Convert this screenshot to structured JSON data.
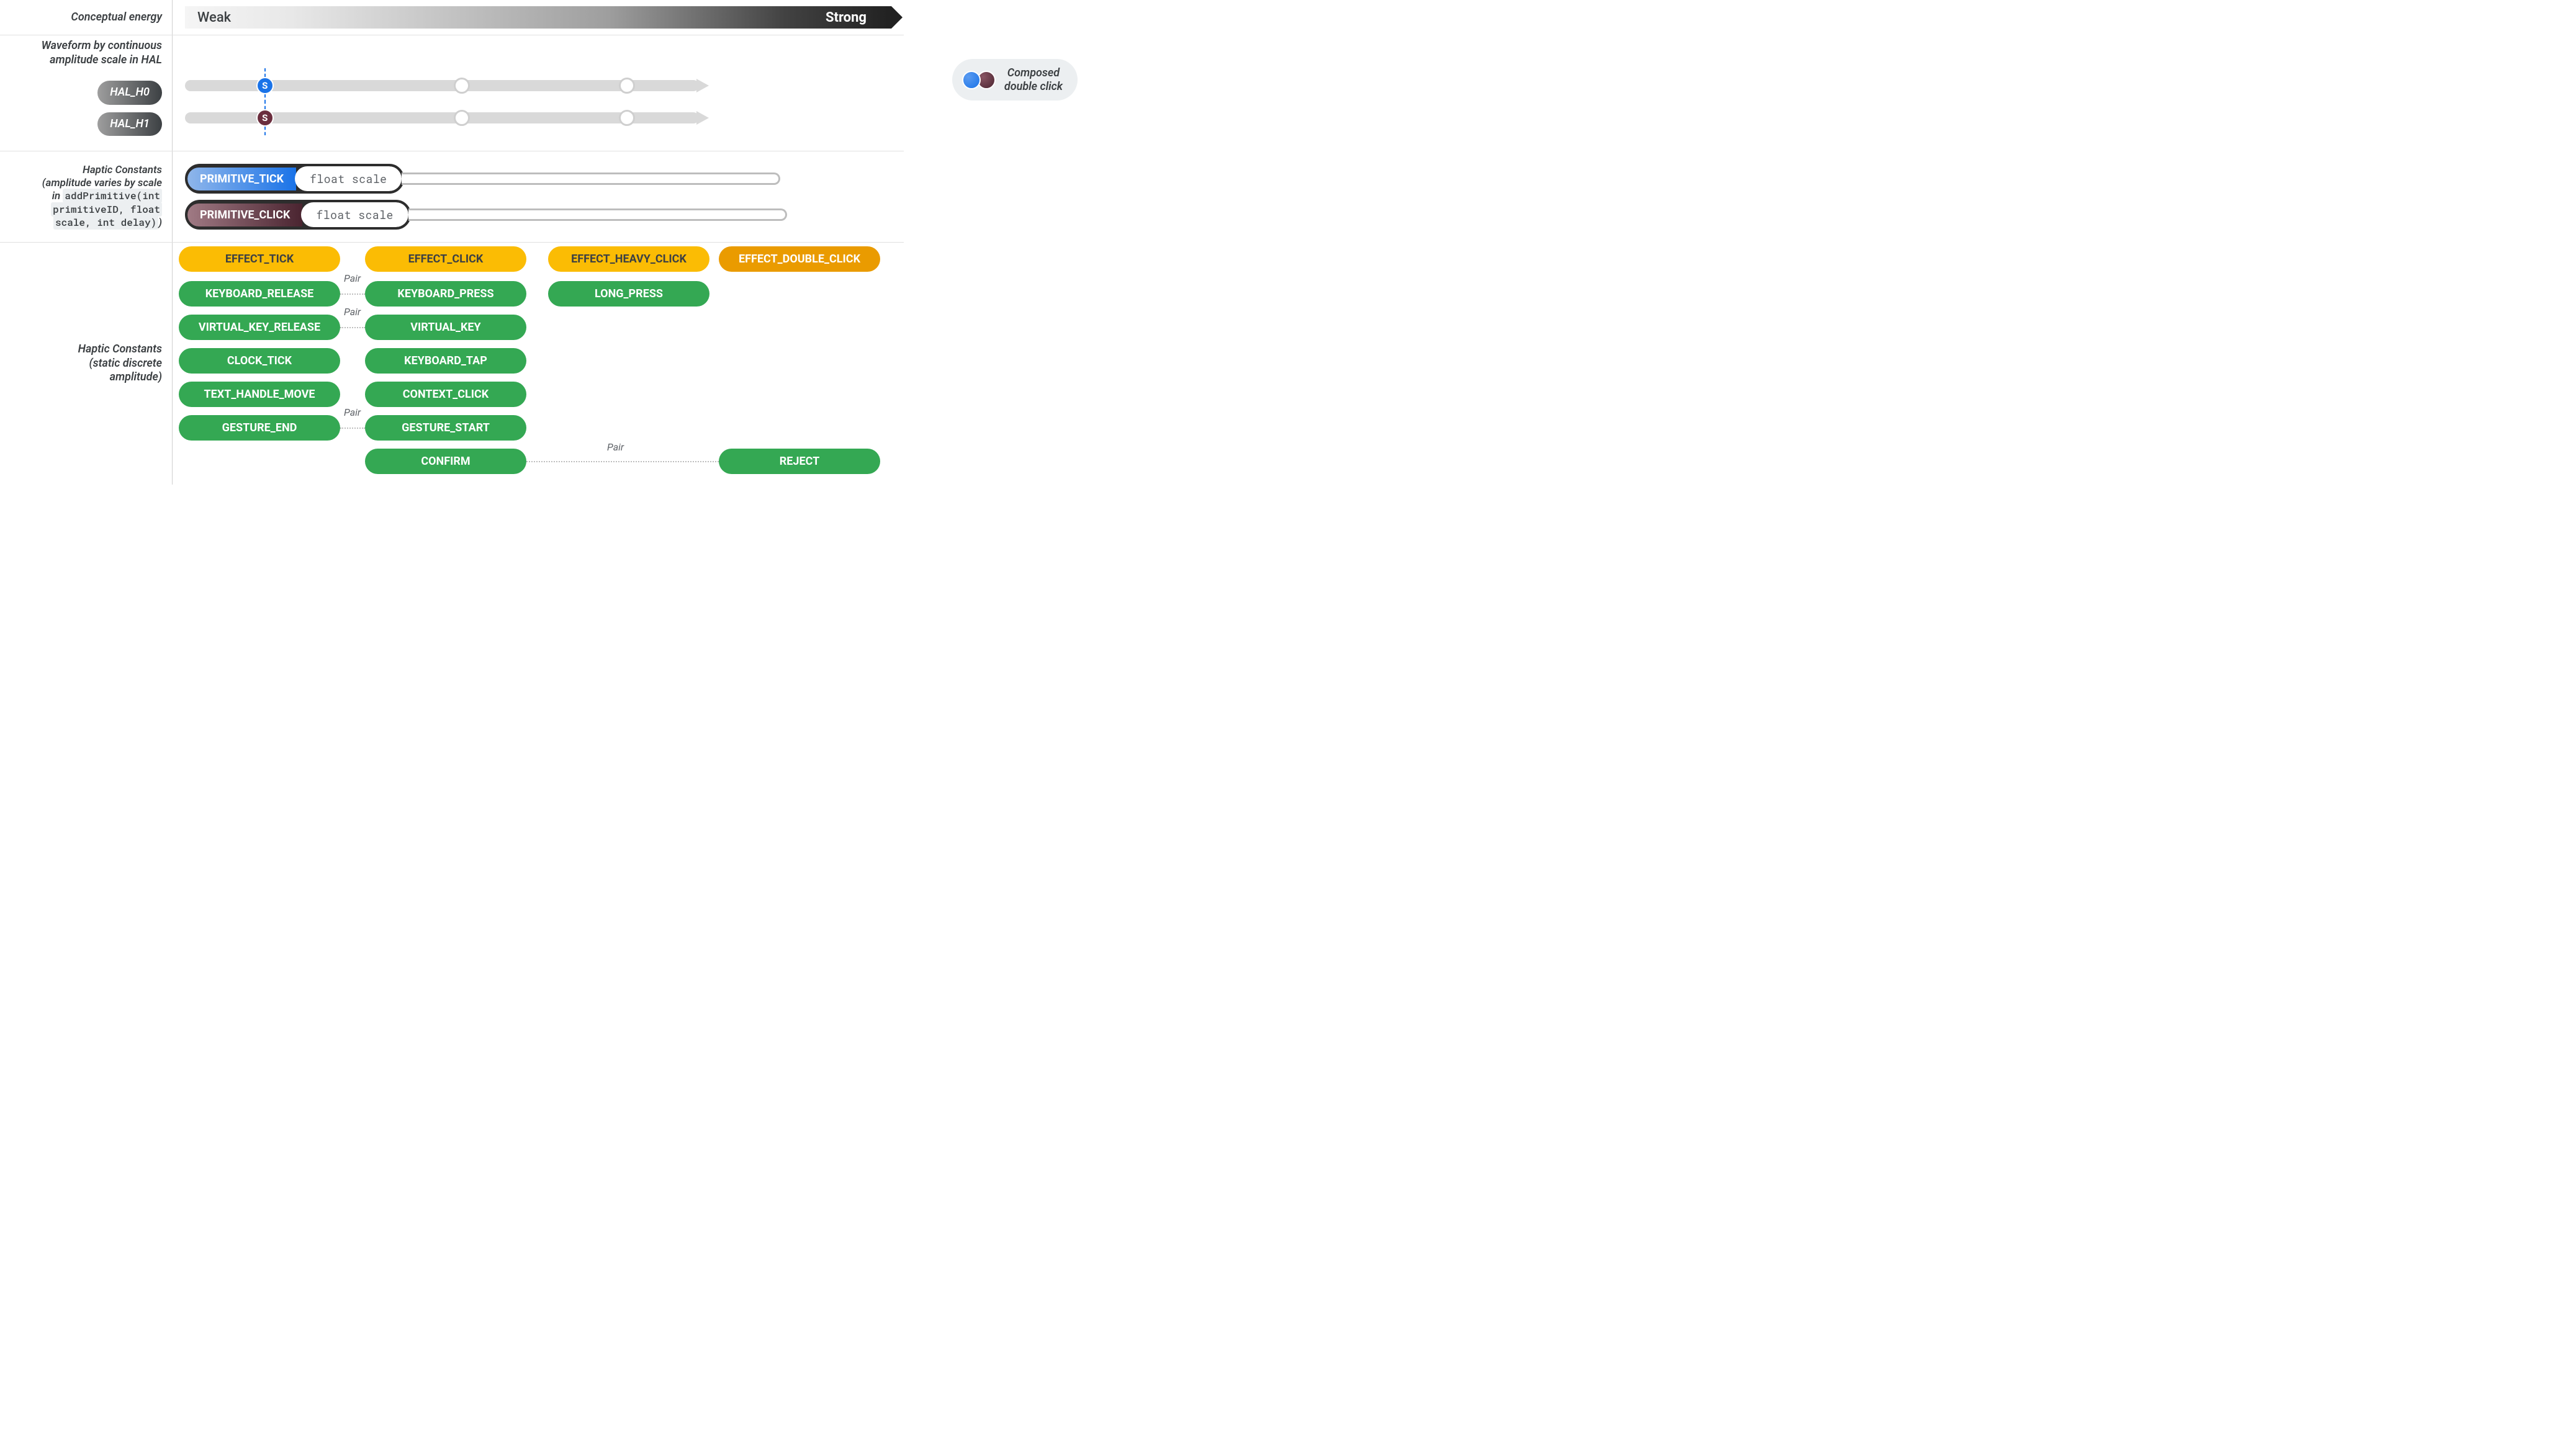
{
  "energy": {
    "title": "Conceptual energy",
    "weak": "Weak",
    "strong": "Strong"
  },
  "waveform": {
    "title_l1": "Waveform by continuous",
    "title_l2": "amplitude scale in HAL",
    "hal_h0": "HAL_H0",
    "hal_h1": "HAL_H1",
    "s_label": "S",
    "composed_l1": "Composed",
    "composed_l2": "double click"
  },
  "primitives": {
    "title_l1": "Haptic Constants",
    "title_l2": "(amplitude varies by scale",
    "title_l3_pre": "in ",
    "title_l3_code": "addPrimitive(int",
    "title_l4_code": "primitiveID, float",
    "title_l5_code": "scale, int delay)",
    "title_l5_post": ")",
    "tick": "PRIMITIVE_TICK",
    "click": "PRIMITIVE_CLICK",
    "float_scale": "float scale"
  },
  "static_row": {
    "title_l1": "Haptic Constants",
    "title_l2": "(static discrete",
    "title_l3": "amplitude)"
  },
  "pair_label": "Pair",
  "effects": {
    "tick": "EFFECT_TICK",
    "click": "EFFECT_CLICK",
    "heavy": "EFFECT_HEAVY_CLICK",
    "double": "EFFECT_DOUBLE_CLICK"
  },
  "constants": {
    "keyboard_release": "KEYBOARD_RELEASE",
    "keyboard_press": "KEYBOARD_PRESS",
    "long_press": "LONG_PRESS",
    "virtual_key_release": "VIRTUAL_KEY_RELEASE",
    "virtual_key": "VIRTUAL_KEY",
    "clock_tick": "CLOCK_TICK",
    "keyboard_tap": "KEYBOARD_TAP",
    "text_handle_move": "TEXT_HANDLE_MOVE",
    "context_click": "CONTEXT_CLICK",
    "gesture_end": "GESTURE_END",
    "gesture_start": "GESTURE_START",
    "confirm": "CONFIRM",
    "reject": "REJECT"
  }
}
